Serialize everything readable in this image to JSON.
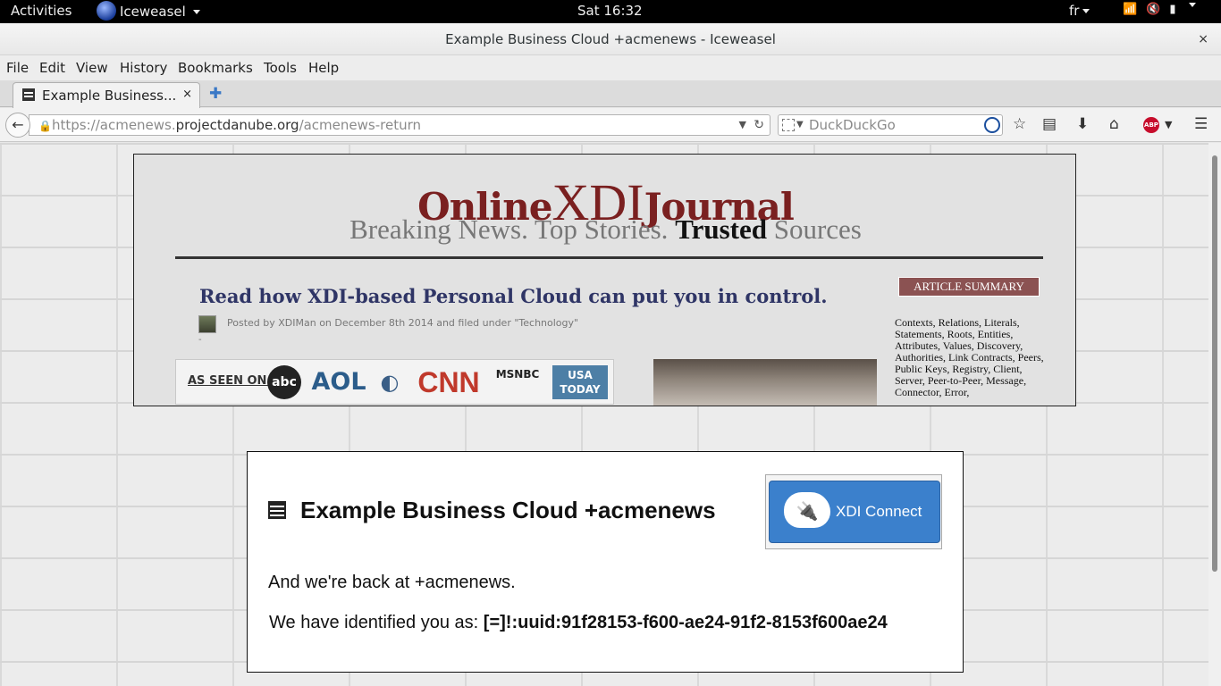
{
  "system_bar": {
    "activities": "Activities",
    "app_name": "Iceweasel",
    "clock": "Sat 16:32",
    "language": "fr"
  },
  "window": {
    "title": "Example Business Cloud +acmenews - Iceweasel",
    "close_glyph": "×"
  },
  "menu": {
    "file": "File",
    "edit": "Edit",
    "view": "View",
    "history": "History",
    "bookmarks": "Bookmarks",
    "tools": "Tools",
    "help": "Help"
  },
  "tabs": [
    {
      "label": "Example Business...",
      "close_glyph": "×"
    }
  ],
  "new_tab_glyph": "✚",
  "navigation": {
    "url_prefix": "https://acmenews.",
    "url_domain": "projectdanube.org",
    "url_path": "/acmenews-return",
    "search_placeholder": "DuckDuckGo",
    "abp_label": "ABP"
  },
  "icons": {
    "back": "arrow-left-icon",
    "lock": "lock-icon",
    "reload": "reload-icon",
    "search": "magnifier-icon",
    "bookmark": "star-icon",
    "reader": "reading-list-icon",
    "download": "download-arrow-icon",
    "home": "home-icon",
    "menu": "hamburger-icon"
  },
  "journal": {
    "masthead_left": "Online",
    "masthead_center": "XDI",
    "masthead_right": "Journal",
    "tagline_start": "Breaking News. Top Stories.",
    "tagline_bold": "Trusted",
    "tagline_end": "Sources",
    "headline": "Read how XDI-based Personal Cloud can put you in control.",
    "byline": "Posted by XDIMan on December 8th 2014 and filed under \"Technology\"",
    "dot": "-",
    "as_seen_on": "AS SEEN ON:",
    "media_logos": [
      "abc",
      "AOL",
      "CNN",
      "MSNBC",
      "USA TODAY"
    ],
    "summary_header": "ARTICLE SUMMARY",
    "summary_text": "Contexts, Relations, Literals, Statements, Roots, Entities, Attributes, Values, Discovery, Authorities, Link Contracts, Peers, Public Keys, Registry, Client, Server, Peer-to-Peer, Message, Connector, Error,"
  },
  "card": {
    "title": "Example Business Cloud +acmenews",
    "connect_button": "XDI Connect",
    "back_message": "And we're back at +acmenews.",
    "identified_prefix": "We have identified you as: ",
    "identity": "[=]!:uuid:91f28153-f600-ae24-91f2-8153f600ae24"
  },
  "colors": {
    "masthead": "#7a2020",
    "headline": "#2f3566",
    "summary_header_bg": "#8b5252",
    "connect_button_bg": "#3b80cc"
  }
}
